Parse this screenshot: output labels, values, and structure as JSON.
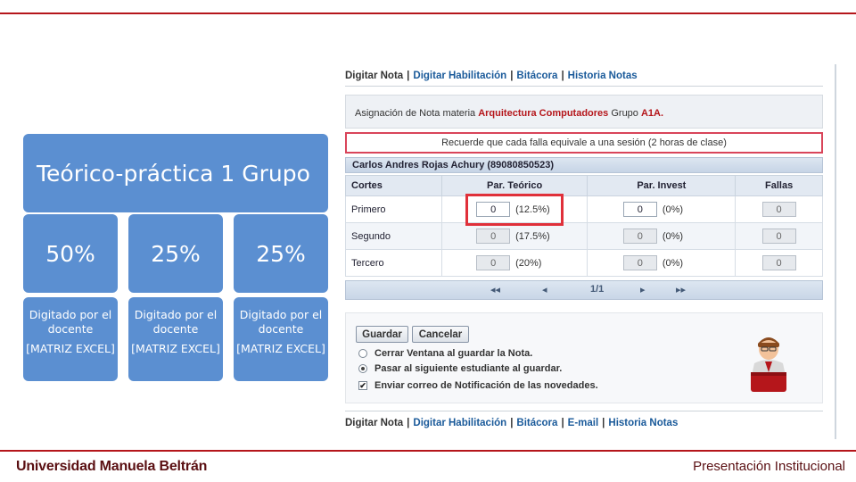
{
  "footer": {
    "institution": "Universidad Manuela Beltrán",
    "presentation": "Presentación Institucional"
  },
  "left_panel": {
    "title": "Teórico-práctica 1 Grupo",
    "blocks": [
      {
        "percent": "50%",
        "line1": "Digitado por el docente",
        "line2": "[MATRIZ EXCEL]"
      },
      {
        "percent": "25%",
        "line1": "Digitado por el docente",
        "line2": "[MATRIZ EXCEL]"
      },
      {
        "percent": "25%",
        "line1": "Digitado por el docente",
        "line2": "[MATRIZ EXCEL]"
      }
    ]
  },
  "app": {
    "nav_top": [
      "Digitar Nota",
      "Digitar Habilitación",
      "Bitácora",
      "Historia Notas"
    ],
    "nav_bottom": [
      "Digitar Nota",
      "Digitar Habilitación",
      "Bitácora",
      "E-mail",
      "Historia Notas"
    ],
    "assignment": {
      "prefix": "Asignación de Nota materia",
      "subject": "Arquitectura Computadores",
      "group_label": "Grupo",
      "group": "A1A."
    },
    "notice": "Recuerde que cada falla equivale a una sesión (2 horas de clase)",
    "student": "Carlos Andres Rojas Achury (89080850523)",
    "table": {
      "headers": [
        "Cortes",
        "Par. Teórico",
        "Par. Invest",
        "Fallas"
      ],
      "rows": [
        {
          "corte": "Primero",
          "teorico": "0",
          "teorico_pct": "(12.5%)",
          "invest": "0",
          "invest_pct": "(0%)",
          "fallas": "0"
        },
        {
          "corte": "Segundo",
          "teorico": "0",
          "teorico_pct": "(17.5%)",
          "invest": "0",
          "invest_pct": "(0%)",
          "fallas": "0"
        },
        {
          "corte": "Tercero",
          "teorico": "0",
          "teorico_pct": "(20%)",
          "invest": "0",
          "invest_pct": "(0%)",
          "fallas": "0"
        }
      ]
    },
    "pager": {
      "page": "1/1"
    },
    "buttons": {
      "save": "Guardar",
      "cancel": "Cancelar"
    },
    "options": [
      {
        "label": "Cerrar Ventana al guardar la Nota.",
        "type": "radio",
        "checked": false
      },
      {
        "label": "Pasar al siguiente estudiante al guardar.",
        "type": "radio",
        "checked": true
      },
      {
        "label": "Enviar correo de Notificación de las novedades.",
        "type": "checkbox",
        "checked": true
      }
    ]
  }
}
